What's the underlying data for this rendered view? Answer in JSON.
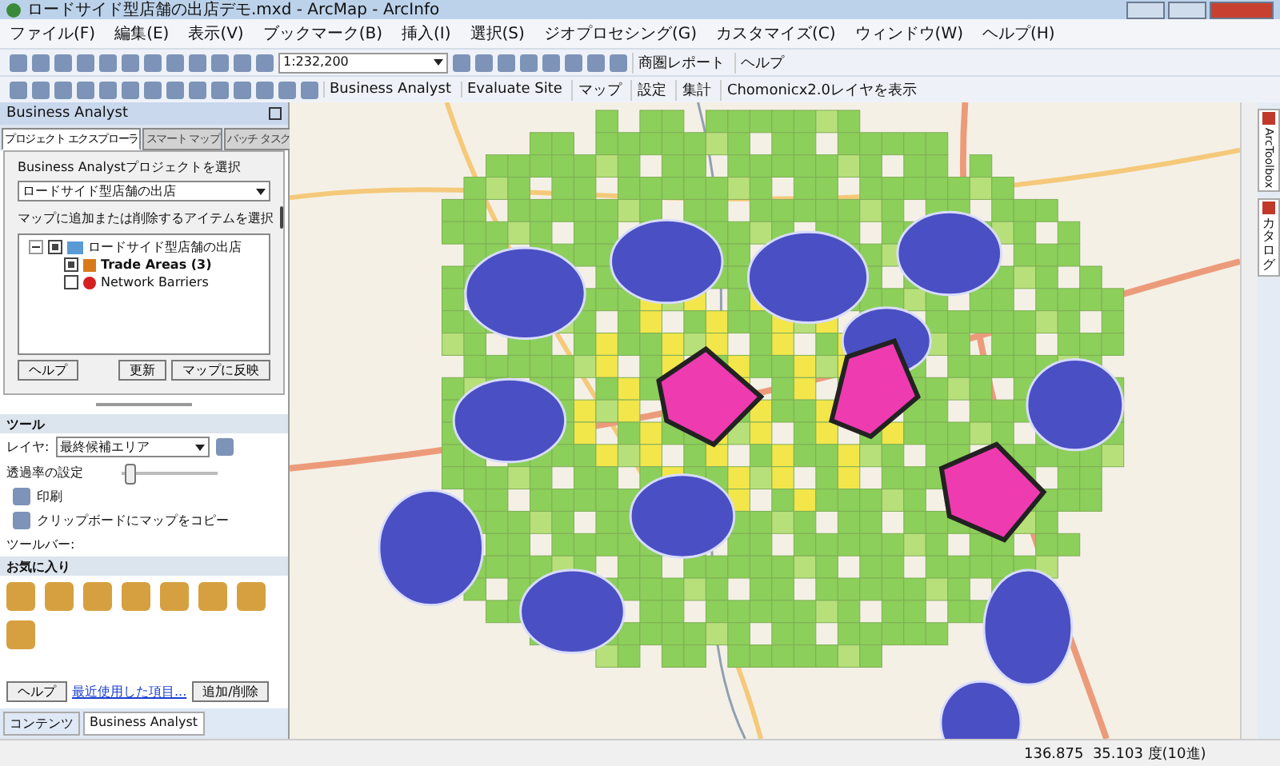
{
  "window": {
    "title": "ロードサイド型店舗の出店デモ.mxd - ArcMap - ArcInfo"
  },
  "menu": [
    "ファイル(F)",
    "編集(E)",
    "表示(V)",
    "ブックマーク(B)",
    "挿入(I)",
    "選択(S)",
    "ジオプロセシング(G)",
    "カスタマイズ(C)",
    "ウィンドウ(W)",
    "ヘルプ(H)"
  ],
  "toolbar_1": {
    "scale": "1:232,200",
    "menus": [
      "商圏レポート",
      "ヘルプ"
    ]
  },
  "toolbar_2": {
    "menus": [
      "Business Analyst",
      "Evaluate Site",
      "マップ",
      "設定",
      "集計"
    ],
    "button": "Chomonicx2.0レイヤを表示"
  },
  "panel": {
    "title": "Business Analyst",
    "tabs": [
      {
        "label": "プロジェクト エクスプローラ",
        "selected": true
      },
      {
        "label": "スマート マップ",
        "selected": false
      },
      {
        "label": "バッチ タスク",
        "selected": false
      }
    ],
    "project_label": "Business Analystプロジェクトを選択",
    "project_value": "ロードサイド型店舗の出店",
    "items_label": "マップに追加または削除するアイテムを選択",
    "tree": [
      {
        "label": "ロードサイド型店舗の出店",
        "checked": true,
        "expanded": true,
        "children": [
          {
            "label": "Trade Areas (3)",
            "checked": true,
            "kind": "trade"
          },
          {
            "label": "Network Barriers",
            "checked": false,
            "kind": "barrier"
          }
        ]
      }
    ],
    "buttons": [
      "ヘルプ",
      "更新",
      "マップに反映"
    ]
  },
  "tools": {
    "title": "ツール",
    "layer_label": "レイヤ:",
    "layer_value": "最終候補エリア",
    "transparency_label": "透過率の設定",
    "transparency": {
      "level": 0.04
    },
    "print": "印刷",
    "copy": "クリップボードにマップをコピー",
    "toolbar_label": "ツールバー:"
  },
  "favorites": {
    "title": "お気に入り",
    "help": "ヘルプ",
    "recent_link": "最近使用した項目...",
    "add_remove": "追加/削除"
  },
  "bottom_tabs": [
    {
      "label": "コンテンツ",
      "selected": false
    },
    {
      "label": "Business Analyst",
      "selected": true
    }
  ],
  "side_tabs": [
    {
      "label": "ArcToolbox",
      "kind": "latin"
    },
    {
      "label": "カタログ",
      "kind": "cjk"
    }
  ],
  "status_bar": {
    "coordinates": "136.875  35.103 度(10進)"
  }
}
